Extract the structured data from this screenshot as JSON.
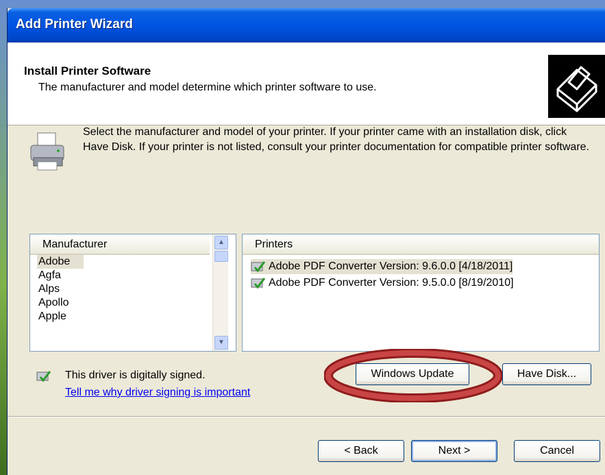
{
  "window": {
    "title": "Add Printer Wizard"
  },
  "header": {
    "title": "Install Printer Software",
    "subtitle": "The manufacturer and model determine which printer software to use."
  },
  "instructions": "Select the manufacturer and model of your printer. If your printer came with an installation disk, click Have Disk. If your printer is not listed, consult your printer documentation for compatible printer software.",
  "manufacturer_list": {
    "header": "Manufacturer",
    "items": [
      "Adobe",
      "Agfa",
      "Alps",
      "Apollo",
      "Apple"
    ],
    "selected": "Adobe"
  },
  "printers_list": {
    "header": "Printers",
    "items": [
      "Adobe PDF Converter Version: 9.6.0.0 [4/18/2011]",
      "Adobe PDF Converter Version: 9.5.0.0 [8/19/2010]"
    ]
  },
  "signing": {
    "status": "This driver is digitally signed.",
    "link": "Tell me why driver signing is important"
  },
  "buttons": {
    "windows_update": "Windows Update",
    "have_disk": "Have Disk...",
    "back": "< Back",
    "next": "Next >",
    "cancel": "Cancel"
  },
  "icons": [
    "wizard-printer-icon",
    "printer-icon",
    "signed-driver-icon",
    "scroll-up-icon",
    "scroll-down-icon"
  ],
  "colors": {
    "titlebar": "#0054e3",
    "dialog": "#ece9d8",
    "link": "#0000ee",
    "highlight_ring": "#b8282a"
  }
}
